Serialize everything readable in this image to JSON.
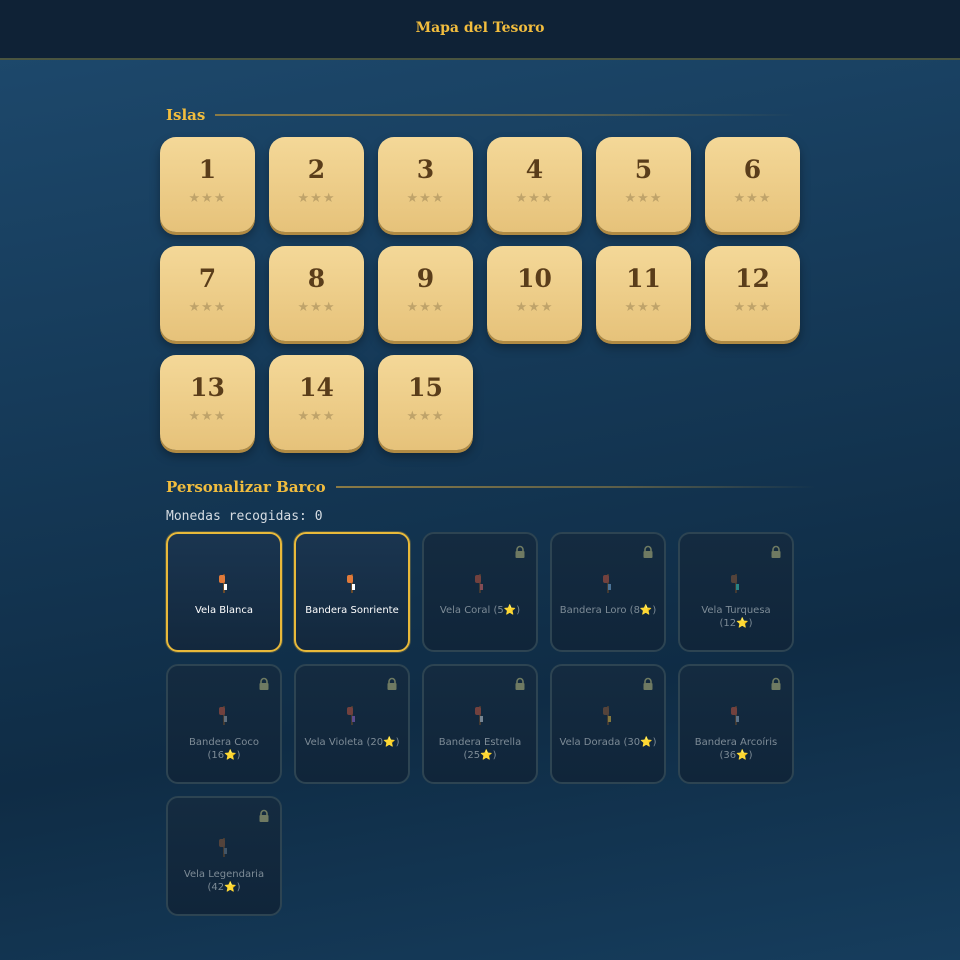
{
  "header": {
    "title": "Mapa del Tesoro"
  },
  "sections": {
    "islands": "Islas",
    "customize": "Personalizar Barco"
  },
  "levels": [
    {
      "number": "1",
      "stars": "★★★"
    },
    {
      "number": "2",
      "stars": "★★★"
    },
    {
      "number": "3",
      "stars": "★★★"
    },
    {
      "number": "4",
      "stars": "★★★"
    },
    {
      "number": "5",
      "stars": "★★★"
    },
    {
      "number": "6",
      "stars": "★★★"
    },
    {
      "number": "7",
      "stars": "★★★"
    },
    {
      "number": "8",
      "stars": "★★★"
    },
    {
      "number": "9",
      "stars": "★★★"
    },
    {
      "number": "10",
      "stars": "★★★"
    },
    {
      "number": "11",
      "stars": "★★★"
    },
    {
      "number": "12",
      "stars": "★★★"
    },
    {
      "number": "13",
      "stars": "★★★"
    },
    {
      "number": "14",
      "stars": "★★★"
    },
    {
      "number": "15",
      "stars": "★★★"
    }
  ],
  "coins": {
    "text": "Monedas recogidas: 0"
  },
  "items": [
    {
      "label": "Vela Blanca",
      "unlocked": true,
      "sail": "#e07a3a",
      "flag": "#ffffff"
    },
    {
      "label": "Bandera Sonriente",
      "unlocked": true,
      "sail": "#e07a3a",
      "flag": "#ffffff"
    },
    {
      "label": "Vela Coral (5⭐)",
      "unlocked": false,
      "sail": "#c0563f",
      "flag": "#e06a6a"
    },
    {
      "label": "Bandera Loro (8⭐)",
      "unlocked": false,
      "sail": "#c0563f",
      "flag": "#7ab0e0"
    },
    {
      "label": "Vela Turquesa (12⭐)",
      "unlocked": false,
      "sail": "#8a5a3a",
      "flag": "#3ad0c0"
    },
    {
      "label": "Bandera Coco (16⭐)",
      "unlocked": false,
      "sail": "#c0563f",
      "flag": "#a0a8b0"
    },
    {
      "label": "Vela Violeta (20⭐)",
      "unlocked": false,
      "sail": "#c0563f",
      "flag": "#9a6ad0"
    },
    {
      "label": "Bandera Estrella (25⭐)",
      "unlocked": false,
      "sail": "#c0563f",
      "flag": "#c8d0d8"
    },
    {
      "label": "Vela Dorada (30⭐)",
      "unlocked": false,
      "sail": "#8a5a3a",
      "flag": "#e0b840"
    },
    {
      "label": "Bandera Arcoíris (36⭐)",
      "unlocked": false,
      "sail": "#c0563f",
      "flag": "#9ab0c8"
    },
    {
      "label": "Vela Legendaria (42⭐)",
      "unlocked": false,
      "sail": "#8a5a3a",
      "flag": "#6a7a8a"
    }
  ],
  "icons": {
    "lock": "lock-icon",
    "star": "star-icon",
    "ship": "ship-icon"
  },
  "colors": {
    "accent": "#f2bd3e",
    "tile": "#e6c27a"
  }
}
